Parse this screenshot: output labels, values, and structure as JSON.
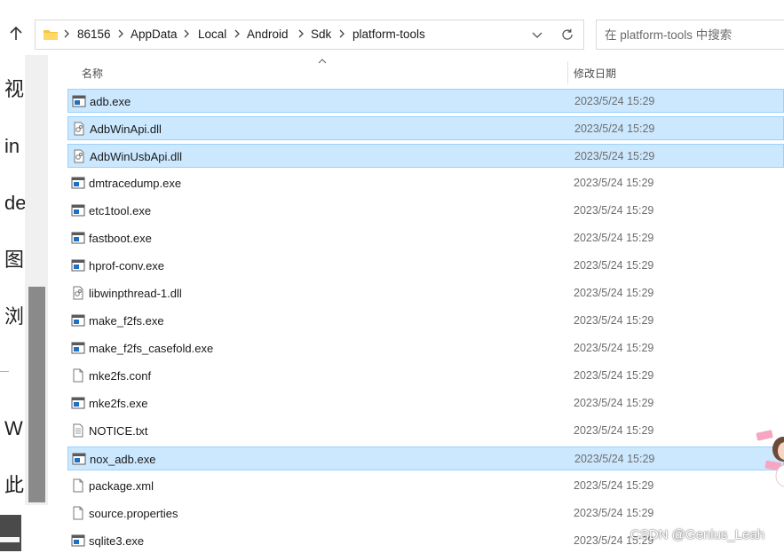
{
  "breadcrumb": {
    "items": [
      "86156",
      "AppData",
      "Local",
      "Android",
      "Sdk",
      "platform-tools"
    ]
  },
  "search": {
    "placeholder": "在 platform-tools 中搜索"
  },
  "columns": {
    "name": "名称",
    "date": "修改日期"
  },
  "files": [
    {
      "name": "adb.exe",
      "date": "2023/5/24 15:29",
      "icon": "exe-icon",
      "selected": true
    },
    {
      "name": "AdbWinApi.dll",
      "date": "2023/5/24 15:29",
      "icon": "dll-icon",
      "selected": true
    },
    {
      "name": "AdbWinUsbApi.dll",
      "date": "2023/5/24 15:29",
      "icon": "dll-icon",
      "selected": true
    },
    {
      "name": "dmtracedump.exe",
      "date": "2023/5/24 15:29",
      "icon": "exe-icon",
      "selected": false
    },
    {
      "name": "etc1tool.exe",
      "date": "2023/5/24 15:29",
      "icon": "exe-icon",
      "selected": false
    },
    {
      "name": "fastboot.exe",
      "date": "2023/5/24 15:29",
      "icon": "exe-icon",
      "selected": false
    },
    {
      "name": "hprof-conv.exe",
      "date": "2023/5/24 15:29",
      "icon": "exe-icon",
      "selected": false
    },
    {
      "name": "libwinpthread-1.dll",
      "date": "2023/5/24 15:29",
      "icon": "dll-icon",
      "selected": false
    },
    {
      "name": "make_f2fs.exe",
      "date": "2023/5/24 15:29",
      "icon": "exe-icon",
      "selected": false
    },
    {
      "name": "make_f2fs_casefold.exe",
      "date": "2023/5/24 15:29",
      "icon": "exe-icon",
      "selected": false
    },
    {
      "name": "mke2fs.conf",
      "date": "2023/5/24 15:29",
      "icon": "file-icon",
      "selected": false
    },
    {
      "name": "mke2fs.exe",
      "date": "2023/5/24 15:29",
      "icon": "exe-icon",
      "selected": false
    },
    {
      "name": "NOTICE.txt",
      "date": "2023/5/24 15:29",
      "icon": "text-file-icon",
      "selected": false
    },
    {
      "name": "nox_adb.exe",
      "date": "2023/5/24 15:29",
      "icon": "exe-icon",
      "selected": true
    },
    {
      "name": "package.xml",
      "date": "2023/5/24 15:29",
      "icon": "file-icon",
      "selected": false
    },
    {
      "name": "source.properties",
      "date": "2023/5/24 15:29",
      "icon": "file-icon",
      "selected": false
    },
    {
      "name": "sqlite3.exe",
      "date": "2023/5/24 15:29",
      "icon": "exe-icon",
      "selected": false
    }
  ],
  "side_text": [
    "视",
    "in",
    "de",
    "图",
    "浏",
    "W",
    "此"
  ],
  "watermark": "CSDN @Genius_Leah",
  "colors": {
    "selection_fill": "#cce8ff",
    "selection_border": "#99d1ff",
    "folder": "#f4c542",
    "exe_icon": "#1e6fc6"
  }
}
